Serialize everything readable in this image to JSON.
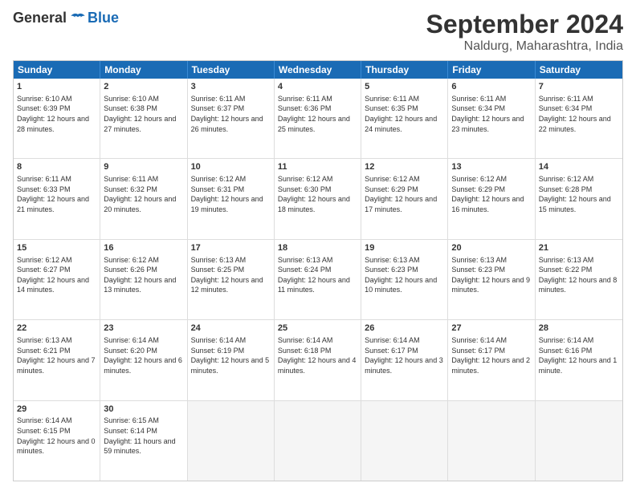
{
  "logo": {
    "general": "General",
    "blue": "Blue"
  },
  "title": "September 2024",
  "subtitle": "Naldurg, Maharashtra, India",
  "headers": [
    "Sunday",
    "Monday",
    "Tuesday",
    "Wednesday",
    "Thursday",
    "Friday",
    "Saturday"
  ],
  "weeks": [
    [
      {
        "day": "1",
        "sunrise": "6:10 AM",
        "sunset": "6:39 PM",
        "daylight": "12 hours and 28 minutes."
      },
      {
        "day": "2",
        "sunrise": "6:10 AM",
        "sunset": "6:38 PM",
        "daylight": "12 hours and 27 minutes."
      },
      {
        "day": "3",
        "sunrise": "6:11 AM",
        "sunset": "6:37 PM",
        "daylight": "12 hours and 26 minutes."
      },
      {
        "day": "4",
        "sunrise": "6:11 AM",
        "sunset": "6:36 PM",
        "daylight": "12 hours and 25 minutes."
      },
      {
        "day": "5",
        "sunrise": "6:11 AM",
        "sunset": "6:35 PM",
        "daylight": "12 hours and 24 minutes."
      },
      {
        "day": "6",
        "sunrise": "6:11 AM",
        "sunset": "6:34 PM",
        "daylight": "12 hours and 23 minutes."
      },
      {
        "day": "7",
        "sunrise": "6:11 AM",
        "sunset": "6:34 PM",
        "daylight": "12 hours and 22 minutes."
      }
    ],
    [
      {
        "day": "8",
        "sunrise": "6:11 AM",
        "sunset": "6:33 PM",
        "daylight": "12 hours and 21 minutes."
      },
      {
        "day": "9",
        "sunrise": "6:11 AM",
        "sunset": "6:32 PM",
        "daylight": "12 hours and 20 minutes."
      },
      {
        "day": "10",
        "sunrise": "6:12 AM",
        "sunset": "6:31 PM",
        "daylight": "12 hours and 19 minutes."
      },
      {
        "day": "11",
        "sunrise": "6:12 AM",
        "sunset": "6:30 PM",
        "daylight": "12 hours and 18 minutes."
      },
      {
        "day": "12",
        "sunrise": "6:12 AM",
        "sunset": "6:29 PM",
        "daylight": "12 hours and 17 minutes."
      },
      {
        "day": "13",
        "sunrise": "6:12 AM",
        "sunset": "6:29 PM",
        "daylight": "12 hours and 16 minutes."
      },
      {
        "day": "14",
        "sunrise": "6:12 AM",
        "sunset": "6:28 PM",
        "daylight": "12 hours and 15 minutes."
      }
    ],
    [
      {
        "day": "15",
        "sunrise": "6:12 AM",
        "sunset": "6:27 PM",
        "daylight": "12 hours and 14 minutes."
      },
      {
        "day": "16",
        "sunrise": "6:12 AM",
        "sunset": "6:26 PM",
        "daylight": "12 hours and 13 minutes."
      },
      {
        "day": "17",
        "sunrise": "6:13 AM",
        "sunset": "6:25 PM",
        "daylight": "12 hours and 12 minutes."
      },
      {
        "day": "18",
        "sunrise": "6:13 AM",
        "sunset": "6:24 PM",
        "daylight": "12 hours and 11 minutes."
      },
      {
        "day": "19",
        "sunrise": "6:13 AM",
        "sunset": "6:23 PM",
        "daylight": "12 hours and 10 minutes."
      },
      {
        "day": "20",
        "sunrise": "6:13 AM",
        "sunset": "6:23 PM",
        "daylight": "12 hours and 9 minutes."
      },
      {
        "day": "21",
        "sunrise": "6:13 AM",
        "sunset": "6:22 PM",
        "daylight": "12 hours and 8 minutes."
      }
    ],
    [
      {
        "day": "22",
        "sunrise": "6:13 AM",
        "sunset": "6:21 PM",
        "daylight": "12 hours and 7 minutes."
      },
      {
        "day": "23",
        "sunrise": "6:14 AM",
        "sunset": "6:20 PM",
        "daylight": "12 hours and 6 minutes."
      },
      {
        "day": "24",
        "sunrise": "6:14 AM",
        "sunset": "6:19 PM",
        "daylight": "12 hours and 5 minutes."
      },
      {
        "day": "25",
        "sunrise": "6:14 AM",
        "sunset": "6:18 PM",
        "daylight": "12 hours and 4 minutes."
      },
      {
        "day": "26",
        "sunrise": "6:14 AM",
        "sunset": "6:17 PM",
        "daylight": "12 hours and 3 minutes."
      },
      {
        "day": "27",
        "sunrise": "6:14 AM",
        "sunset": "6:17 PM",
        "daylight": "12 hours and 2 minutes."
      },
      {
        "day": "28",
        "sunrise": "6:14 AM",
        "sunset": "6:16 PM",
        "daylight": "12 hours and 1 minute."
      }
    ],
    [
      {
        "day": "29",
        "sunrise": "6:14 AM",
        "sunset": "6:15 PM",
        "daylight": "12 hours and 0 minutes."
      },
      {
        "day": "30",
        "sunrise": "6:15 AM",
        "sunset": "6:14 PM",
        "daylight": "11 hours and 59 minutes."
      },
      {
        "day": "",
        "sunrise": "",
        "sunset": "",
        "daylight": ""
      },
      {
        "day": "",
        "sunrise": "",
        "sunset": "",
        "daylight": ""
      },
      {
        "day": "",
        "sunrise": "",
        "sunset": "",
        "daylight": ""
      },
      {
        "day": "",
        "sunrise": "",
        "sunset": "",
        "daylight": ""
      },
      {
        "day": "",
        "sunrise": "",
        "sunset": "",
        "daylight": ""
      }
    ]
  ]
}
